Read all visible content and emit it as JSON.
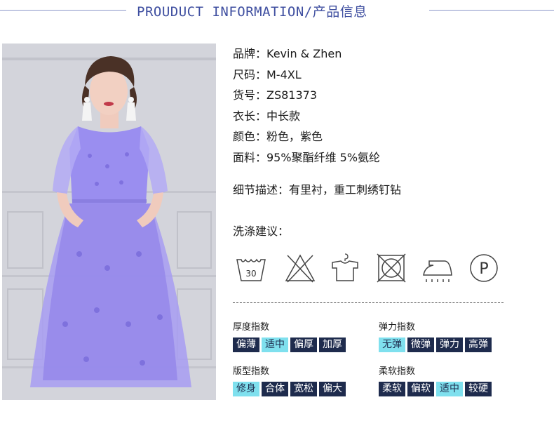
{
  "header": {
    "title": "PROUDUCT INFORMATION/产品信息"
  },
  "info": {
    "brand": "品牌：Kevin & Zhen",
    "size": "尺码：M-4XL",
    "sku": "货号：ZS81373",
    "length": "衣长：中长款",
    "color": "颜色：粉色，紫色",
    "fabric": "面料：95%聚酯纤维 5%氨纶"
  },
  "detail": "细节描述：有里衬，重工刺绣钉钻",
  "wash_title": "洗涤建议：",
  "wash_icons": [
    "wash-30-icon",
    "no-bleach-icon",
    "hang-dry-icon",
    "no-tumble-dry-icon",
    "iron-icon",
    "dry-clean-p-icon"
  ],
  "wash_icon_text": {
    "temp": "30",
    "drycleaning": "P"
  },
  "indices": {
    "thickness": {
      "label": "厚度指数",
      "options": [
        "偏薄",
        "适中",
        "偏厚",
        "加厚"
      ],
      "selected": "适中"
    },
    "elasticity": {
      "label": "弹力指数",
      "options": [
        "无弹",
        "微弹",
        "弹力",
        "高弹"
      ],
      "selected": "无弹"
    },
    "fit": {
      "label": "版型指数",
      "options": [
        "修身",
        "合体",
        "宽松",
        "偏大"
      ],
      "selected": "修身"
    },
    "softness": {
      "label": "柔软指数",
      "options": [
        "柔软",
        "偏软",
        "适中",
        "较硬"
      ],
      "selected": "适中"
    }
  },
  "colors": {
    "accent": "#3f4fa0",
    "tag_bg": "#1e2b4d",
    "tag_selected_bg": "#7fe0ee",
    "dress": "#9a8ef0"
  }
}
